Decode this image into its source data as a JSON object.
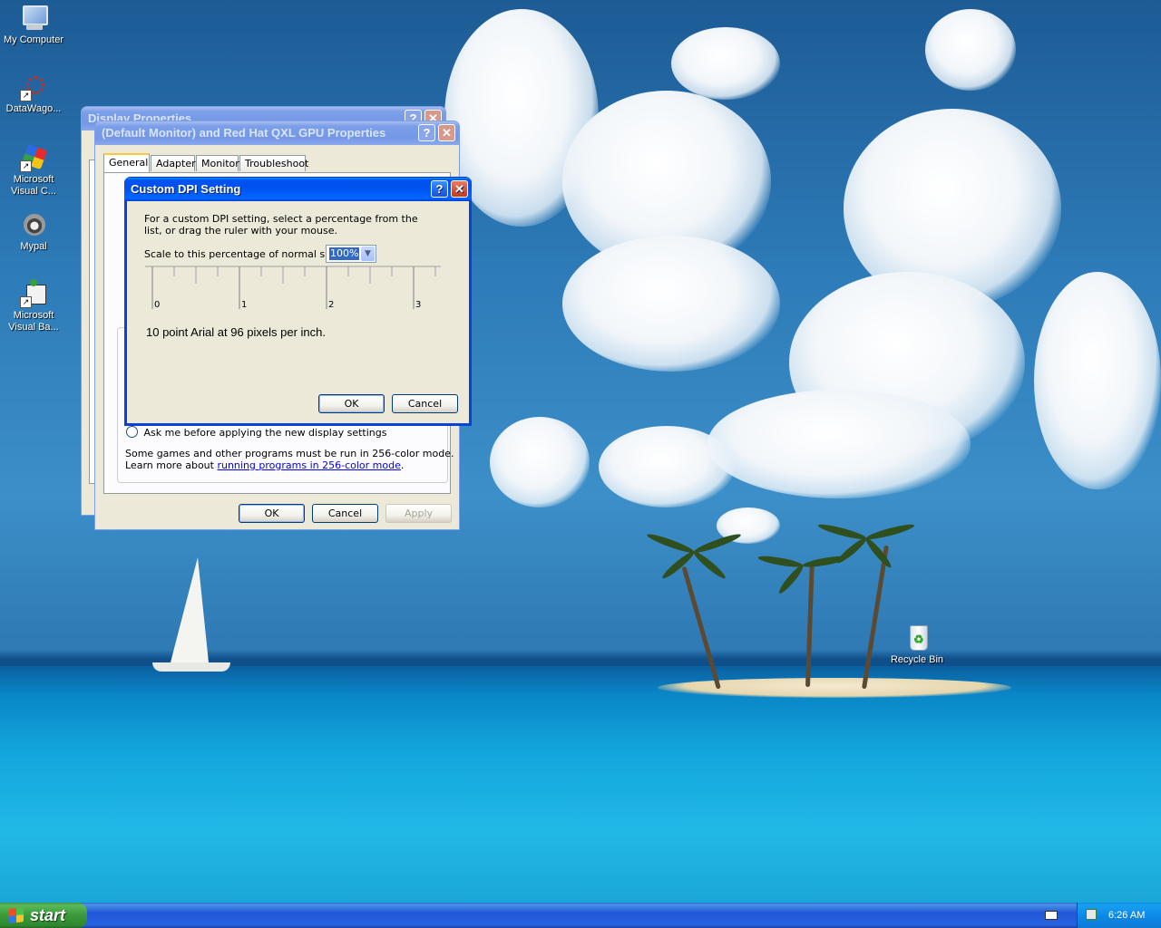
{
  "desktop": {
    "icons": [
      {
        "label": "My Computer"
      },
      {
        "label": "DataWago..."
      },
      {
        "label": "Microsoft Visual C..."
      },
      {
        "label": "Mypal"
      },
      {
        "label": "Microsoft Visual Ba..."
      },
      {
        "label": "Recycle Bin"
      }
    ]
  },
  "display_properties": {
    "title": "Display Properties"
  },
  "gpu_properties": {
    "title": "(Default Monitor) and Red Hat QXL GPU Properties",
    "tabs": [
      "General",
      "Adapter",
      "Monitor",
      "Troubleshoot"
    ],
    "radio_label": "Ask me before applying the new display settings",
    "note_line1": "Some games and other programs must be run in 256-color mode.",
    "note_prefix": "Learn more about ",
    "note_link": "running programs in 256-color mode",
    "note_suffix": ".",
    "ok": "OK",
    "cancel": "Cancel",
    "apply": "Apply"
  },
  "custom_dpi": {
    "title": "Custom DPI Setting",
    "instructions": "For a custom DPI setting, select a percentage from the list, or drag the ruler with your mouse.",
    "scale_label": "Scale to this percentage of normal size:",
    "scale_value": "100%",
    "ruler_labels": [
      "0",
      "1",
      "2",
      "3"
    ],
    "sample_text": "10 point Arial at 96 pixels per inch.",
    "ok": "OK",
    "cancel": "Cancel"
  },
  "taskbar": {
    "start_label": "start",
    "clock": "6:26 AM"
  },
  "icons": {
    "help": "?",
    "close": "✕",
    "dropdown": "chevron-down-icon"
  }
}
